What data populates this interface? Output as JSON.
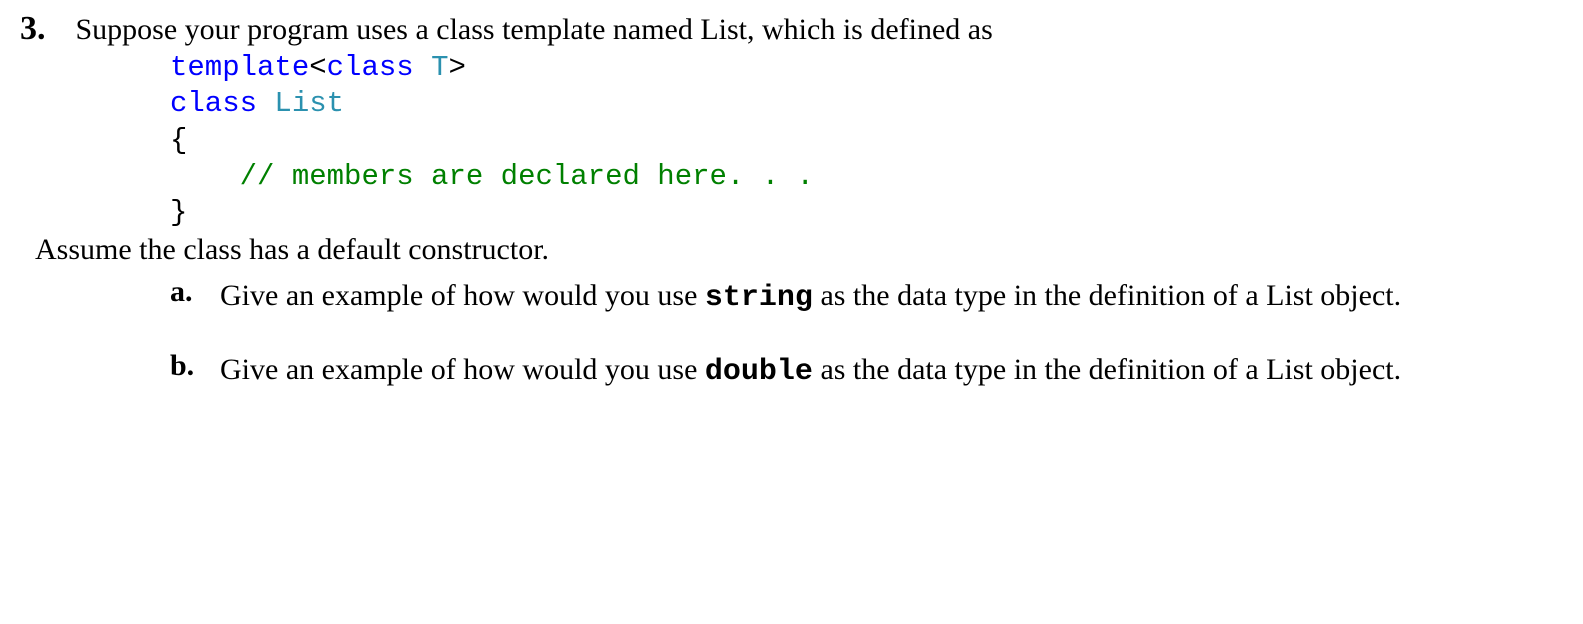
{
  "question": {
    "number": "3.",
    "intro": "Suppose your program uses a class template named List, which is defined as",
    "code": {
      "line1_kw1": "template",
      "line1_lt": "<",
      "line1_kw2": "class",
      "line1_sp": " ",
      "line1_t": "T",
      "line1_gt": ">",
      "line2_kw": "class",
      "line2_sp": " ",
      "line2_name": "List",
      "line3": "{",
      "line4_indent": "    ",
      "line4_comment": "// members are declared here. . .",
      "line5": "}"
    },
    "assume": "Assume the class has a default constructor.",
    "parts": {
      "a": {
        "label": "a.",
        "pre": "Give an example of how would you use ",
        "code": "string",
        "post": " as the data type in the definition of a List object."
      },
      "b": {
        "label": "b.",
        "pre": "Give an example of how would you use ",
        "code": "double",
        "post": " as the data type in the definition of a List object."
      }
    }
  }
}
